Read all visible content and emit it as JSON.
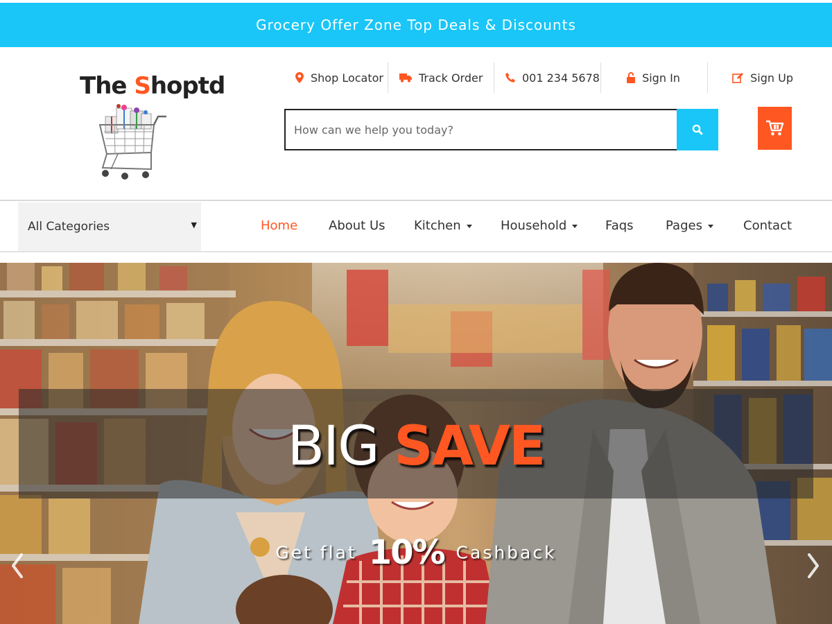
{
  "topbar": {
    "text": "Grocery Offer Zone Top Deals & Discounts"
  },
  "logo": {
    "prefix": "T",
    "part1": "he ",
    "accent": "S",
    "part2": "hoptd"
  },
  "toplinks": [
    {
      "label": "Shop Locator",
      "icon": "map-marker-icon"
    },
    {
      "label": "Track Order",
      "icon": "truck-icon"
    },
    {
      "label": "001 234 5678",
      "icon": "phone-icon"
    },
    {
      "label": "Sign In",
      "icon": "unlock-icon"
    },
    {
      "label": "Sign Up",
      "icon": "edit-icon"
    }
  ],
  "search": {
    "placeholder": "How can we help you today?",
    "value": ""
  },
  "category_select": {
    "selected": "All Categories"
  },
  "menu": [
    {
      "label": "Home",
      "active": true,
      "dropdown": false
    },
    {
      "label": "About Us",
      "active": false,
      "dropdown": false
    },
    {
      "label": "Kitchen",
      "active": false,
      "dropdown": true
    },
    {
      "label": "Household",
      "active": false,
      "dropdown": true
    },
    {
      "label": "Faqs",
      "active": false,
      "dropdown": false
    },
    {
      "label": "Pages",
      "active": false,
      "dropdown": true
    },
    {
      "label": "Contact",
      "active": false,
      "dropdown": false
    }
  ],
  "hero": {
    "title_white": "BIG ",
    "title_accent": "SAVE",
    "sub_before": "Get flat ",
    "sub_big": "10%",
    "sub_after": " Cashback"
  },
  "colors": {
    "accent": "#ff5722",
    "brand_blue": "#19c6f7",
    "text": "#333333"
  }
}
